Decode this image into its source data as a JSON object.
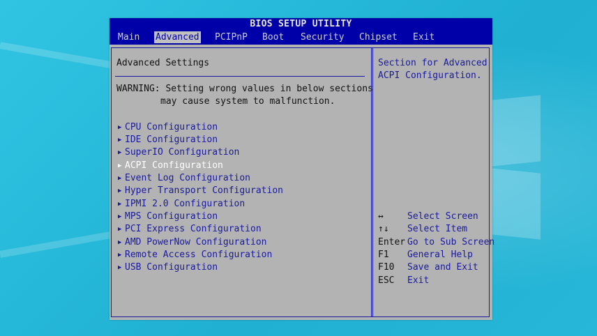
{
  "window": {
    "title": "BIOS SETUP UTILITY"
  },
  "menu": [
    {
      "label": "Main"
    },
    {
      "label": "Advanced"
    },
    {
      "label": "PCIPnP"
    },
    {
      "label": "Boot"
    },
    {
      "label": "Security"
    },
    {
      "label": "Chipset"
    },
    {
      "label": "Exit"
    }
  ],
  "active_menu": "Advanced",
  "main": {
    "heading": "Advanced Settings",
    "warning_line1": "WARNING: Setting wrong values in below sections",
    "warning_line2": "may cause system to malfunction.",
    "items": [
      {
        "label": "CPU Configuration"
      },
      {
        "label": "IDE Configuration"
      },
      {
        "label": "SuperIO Configuration"
      },
      {
        "label": "ACPI Configuration"
      },
      {
        "label": "Event Log Configuration"
      },
      {
        "label": "Hyper Transport Configuration"
      },
      {
        "label": "IPMI 2.0 Configuration"
      },
      {
        "label": "MPS Configuration"
      },
      {
        "label": "PCI Express Configuration"
      },
      {
        "label": "AMD PowerNow Configuration"
      },
      {
        "label": "Remote Access Configuration"
      },
      {
        "label": "USB Configuration"
      }
    ],
    "selected_item": "ACPI Configuration"
  },
  "help": {
    "line1": "Section for Advanced",
    "line2": "ACPI Configuration.",
    "keys": [
      {
        "key": "↔",
        "desc": "Select Screen"
      },
      {
        "key": "↑↓",
        "desc": "Select Item"
      },
      {
        "key": "Enter",
        "desc": "Go to Sub Screen"
      },
      {
        "key": "F1",
        "desc": "General Help"
      },
      {
        "key": "F10",
        "desc": "Save and Exit"
      },
      {
        "key": "ESC",
        "desc": "Exit"
      }
    ]
  },
  "colors": {
    "bios_blue": "#0000a8",
    "bios_gray": "#b3b3b3",
    "text_blue": "#1a1a9c",
    "background": "#2bb8d6"
  },
  "icons": {
    "item_marker": "▶"
  }
}
